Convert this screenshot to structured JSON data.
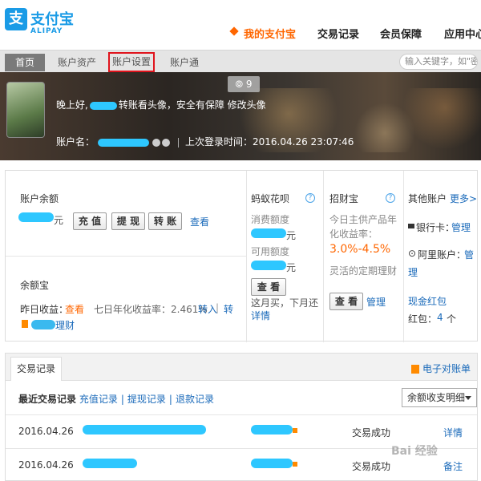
{
  "logo": {
    "cn": "支付宝",
    "en": "ALIPAY",
    "mark": "支"
  },
  "mainnav": [
    {
      "label": "我的支付宝",
      "active": true
    },
    {
      "label": "交易记录",
      "active": false
    },
    {
      "label": "会员保障",
      "active": false
    },
    {
      "label": "应用中心",
      "active": false
    }
  ],
  "subnav": {
    "home": "首页",
    "assets": "账户资产",
    "settings": "账户设置",
    "tong": "账户通",
    "search_placeholder": "输入关键字，如\"密"
  },
  "banner": {
    "msg_count": "9",
    "greet_prefix": "晚上好,",
    "greet_suffix": "转账看头像，安全有保障 修改头像",
    "acct_label": "账户名：",
    "last_login": "上次登录时间：2016.04.26 23:07:46"
  },
  "balance": {
    "title": "账户余额",
    "unit": "元",
    "btn_recharge": "充 值",
    "btn_withdraw": "提 现",
    "btn_transfer": "转 账",
    "view": "查看"
  },
  "yuebao": {
    "title": "余额宝",
    "yesterday_label": "昨日收益：",
    "yesterday_link": "查看",
    "rate": "七日年化收益率：2.461%",
    "in": "转入",
    "sep": "|",
    "out": "转",
    "extra": "理财"
  },
  "huabei": {
    "title": "蚂蚁花呗",
    "consume_label": "消费额度",
    "available_label": "可用额度",
    "unit": "元",
    "btn": "查 看",
    "note": "这月买，下月还",
    "detail": "详情"
  },
  "zhaocai": {
    "title": "招财宝",
    "desc1": "今日主供产品年",
    "desc2": "化收益率：",
    "rate": "3.0%-4.5%",
    "desc3": "灵活的定期理财",
    "btn": "查 看",
    "manage": "管理"
  },
  "other": {
    "title": "其他账户",
    "more": "更多>",
    "bank_label": "银行卡：",
    "bank_manage": "管理",
    "ali_label": "阿里账户：",
    "ali_manage": "管",
    "ali_manage2": "理",
    "cash": "现金红包",
    "hongbao_label": "红包：",
    "hongbao_count": "4",
    "hongbao_unit": "个"
  },
  "tx": {
    "tab": "交易记录",
    "bill": "电子对账单",
    "filter_recent": "最近交易记录",
    "filter_recharge": "充值记录",
    "filter_withdraw": "提现记录",
    "filter_refund": "退款记录",
    "filter_sep": "|",
    "select_value": "余额收支明细",
    "rows": [
      {
        "date": "2016.04.26",
        "status": "交易成功",
        "action": "详情"
      },
      {
        "date": "2016.04.26",
        "status": "交易成功",
        "action": "备注"
      }
    ]
  },
  "watermark": "Bai 经验"
}
